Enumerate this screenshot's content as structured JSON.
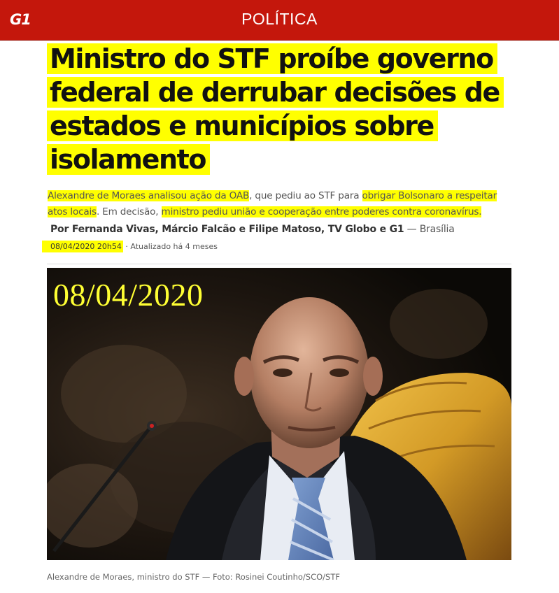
{
  "header": {
    "logo": "G1",
    "section": "POLÍTICA",
    "brand_color": "#c4170c"
  },
  "article": {
    "headline_lines": [
      "Ministro do STF proíbe governo",
      "federal de derrubar decisões de",
      "estados e municípios sobre",
      "isolamento"
    ],
    "subtitle": {
      "part1": "Alexandre de Moraes analisou ação da OAB",
      "part2": ", que pediu ao STF para ",
      "part3": "obrigar Bolsonaro a respeitar atos locais",
      "part4": ". Em decisão, ",
      "part5": "ministro pediu união e cooperação entre poderes contra coronavírus."
    },
    "byline_authors": "Por Fernanda Vivas, Márcio Falcão e Filipe Matoso, TV Globo e G1",
    "byline_sep": " — ",
    "byline_place": "Brasília",
    "published": "08/04/2020 20h54",
    "updated": " · Atualizado há 4 meses",
    "highlight_color": "#ffff00"
  },
  "photo": {
    "overlay_date": "08/04/2020",
    "overlay_color": "#ffff33",
    "caption": "Alexandre de Moraes, ministro do STF — Foto: Rosinei Coutinho/SCO/STF"
  }
}
